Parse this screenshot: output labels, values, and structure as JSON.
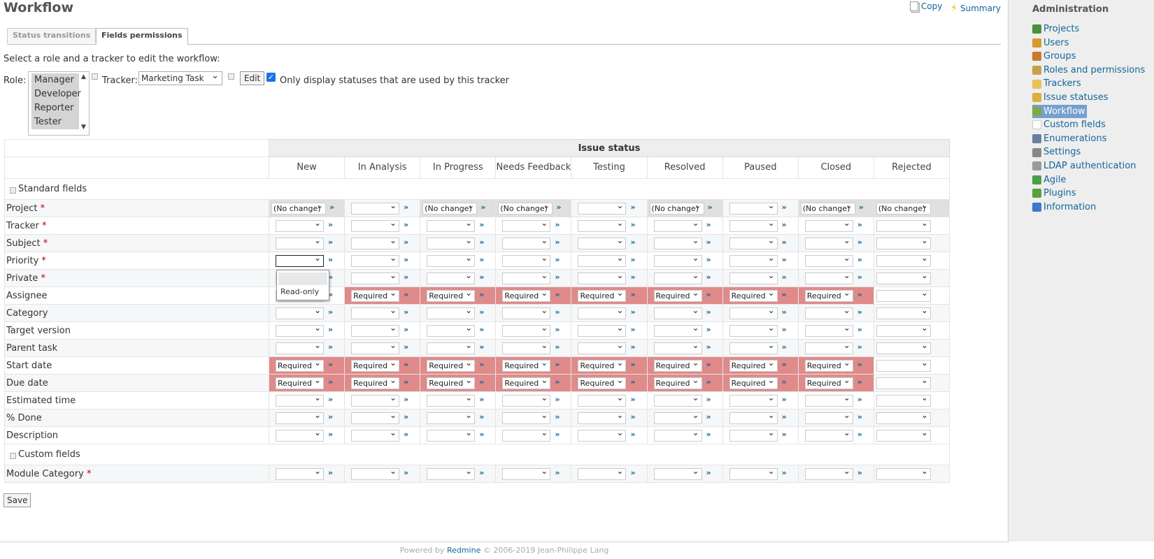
{
  "page": {
    "title": "Workflow"
  },
  "contextual": {
    "copy": "Copy",
    "summary": "Summary"
  },
  "tabs": [
    {
      "label": "Status transitions"
    },
    {
      "label": "Fields permissions"
    }
  ],
  "intro": "Select a role and a tracker to edit the workflow:",
  "role": {
    "label": "Role:",
    "options": [
      "Manager",
      "Developer",
      "Reporter",
      "Tester"
    ]
  },
  "tracker": {
    "label": "Tracker:",
    "value": "Marketing Task"
  },
  "edit_button": "Edit",
  "only_used": {
    "label": "Only display statuses that are used by this tracker",
    "checked": true
  },
  "table": {
    "group_header": "Issue status",
    "statuses": [
      "New",
      "In Analysis",
      "In Progress",
      "Needs Feedback",
      "Testing",
      "Resolved",
      "Paused",
      "Closed",
      "Rejected"
    ],
    "sections": [
      {
        "label": "Standard fields",
        "rows": [
          {
            "name": "Project",
            "required": true,
            "values": [
              "(No change)",
              "",
              "(No change)",
              "(No change)",
              "",
              "(No change)",
              "",
              "(No change)",
              "(No change)"
            ]
          },
          {
            "name": "Tracker",
            "required": true,
            "values": [
              "",
              "",
              "",
              "",
              "",
              "",
              "",
              "",
              ""
            ]
          },
          {
            "name": "Subject",
            "required": true,
            "values": [
              "",
              "",
              "",
              "",
              "",
              "",
              "",
              "",
              ""
            ]
          },
          {
            "name": "Priority",
            "required": true,
            "values": [
              "",
              "",
              "",
              "",
              "",
              "",
              "",
              "",
              ""
            ]
          },
          {
            "name": "Private",
            "required": true,
            "values": [
              "",
              "",
              "",
              "",
              "",
              "",
              "",
              "",
              ""
            ]
          },
          {
            "name": "Assignee",
            "required": false,
            "values": [
              "",
              "Required",
              "Required",
              "Required",
              "Required",
              "Required",
              "Required",
              "Required",
              ""
            ]
          },
          {
            "name": "Category",
            "required": false,
            "values": [
              "",
              "",
              "",
              "",
              "",
              "",
              "",
              "",
              ""
            ]
          },
          {
            "name": "Target version",
            "required": false,
            "values": [
              "",
              "",
              "",
              "",
              "",
              "",
              "",
              "",
              ""
            ]
          },
          {
            "name": "Parent task",
            "required": false,
            "values": [
              "",
              "",
              "",
              "",
              "",
              "",
              "",
              "",
              ""
            ]
          },
          {
            "name": "Start date",
            "required": false,
            "values": [
              "Required",
              "Required",
              "Required",
              "Required",
              "Required",
              "Required",
              "Required",
              "Required",
              ""
            ]
          },
          {
            "name": "Due date",
            "required": false,
            "values": [
              "Required",
              "Required",
              "Required",
              "Required",
              "Required",
              "Required",
              "Required",
              "Required",
              ""
            ]
          },
          {
            "name": "Estimated time",
            "required": false,
            "values": [
              "",
              "",
              "",
              "",
              "",
              "",
              "",
              "",
              ""
            ]
          },
          {
            "name": "% Done",
            "required": false,
            "values": [
              "",
              "",
              "",
              "",
              "",
              "",
              "",
              "",
              ""
            ]
          },
          {
            "name": "Description",
            "required": false,
            "values": [
              "",
              "",
              "",
              "",
              "",
              "",
              "",
              "",
              ""
            ]
          }
        ]
      },
      {
        "label": "Custom fields",
        "rows": [
          {
            "name": "Module Category",
            "required": true,
            "values": [
              "",
              "",
              "",
              "",
              "",
              "",
              "",
              "",
              ""
            ]
          }
        ]
      }
    ]
  },
  "dropdown_popup": {
    "options": [
      "",
      "Read-only"
    ]
  },
  "save_button": "Save",
  "sidebar": {
    "title": "Administration",
    "items": [
      {
        "label": "Projects",
        "icon": "projects-icon",
        "color": "#4a8f3c"
      },
      {
        "label": "Users",
        "icon": "users-icon",
        "color": "#d89a2c"
      },
      {
        "label": "Groups",
        "icon": "groups-icon",
        "color": "#c97a2a"
      },
      {
        "label": "Roles and permissions",
        "icon": "roles-icon",
        "color": "#c9a04a"
      },
      {
        "label": "Trackers",
        "icon": "trackers-icon",
        "color": "#e8c25a"
      },
      {
        "label": "Issue statuses",
        "icon": "issue-statuses-icon",
        "color": "#d8b040"
      },
      {
        "label": "Workflow",
        "icon": "workflow-icon",
        "color": "#7fa84a",
        "selected": true
      },
      {
        "label": "Custom fields",
        "icon": "custom-fields-icon",
        "color": "#ffffff"
      },
      {
        "label": "Enumerations",
        "icon": "enumerations-icon",
        "color": "#6a7fa0"
      },
      {
        "label": "Settings",
        "icon": "settings-icon",
        "color": "#888888"
      },
      {
        "label": "LDAP authentication",
        "icon": "ldap-icon",
        "color": "#9a9a9a"
      },
      {
        "label": "Agile",
        "icon": "agile-icon",
        "color": "#4aa04a"
      },
      {
        "label": "Plugins",
        "icon": "plugins-icon",
        "color": "#5aa03a"
      },
      {
        "label": "Information",
        "icon": "information-icon",
        "color": "#3a7ac8"
      }
    ]
  },
  "footer": {
    "prefix": "Powered by ",
    "link": "Redmine",
    "suffix": " © 2006-2019 Jean-Philippe Lang"
  }
}
